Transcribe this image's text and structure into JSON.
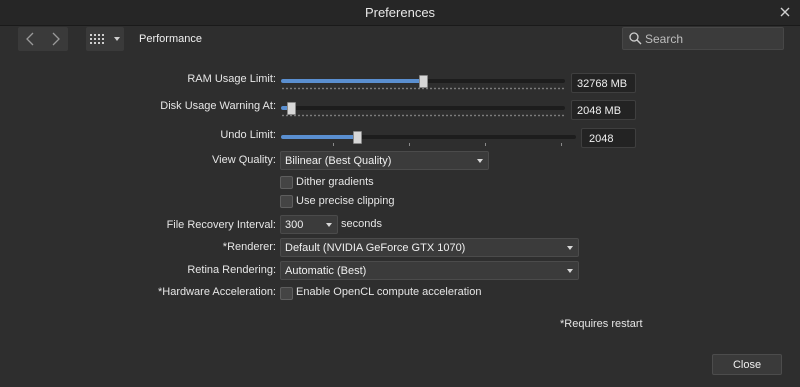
{
  "window": {
    "title": "Preferences"
  },
  "toolbar": {
    "section_label": "Performance",
    "search_placeholder": "Search"
  },
  "settings": {
    "ram": {
      "label": "RAM Usage Limit:",
      "value": "32768 MB",
      "level": 0.5
    },
    "disk": {
      "label": "Disk Usage Warning At:",
      "value": "2048 MB",
      "level": 0.02
    },
    "undo": {
      "label": "Undo Limit:",
      "value": "2048",
      "level": 0.25
    },
    "view_quality": {
      "label": "View Quality:",
      "value": "Bilinear (Best Quality)"
    },
    "dither": {
      "label": "Dither gradients",
      "checked": false
    },
    "precise_clipping": {
      "label": "Use precise clipping",
      "checked": false
    },
    "file_recovery": {
      "label": "File Recovery Interval:",
      "value": "300",
      "unit": "seconds"
    },
    "renderer": {
      "label": "*Renderer:",
      "value": "Default (NVIDIA GeForce GTX 1070)"
    },
    "retina": {
      "label": "Retina Rendering:",
      "value": "Automatic (Best)"
    },
    "hw_accel": {
      "label": "*Hardware Acceleration:",
      "checkbox_label": "Enable OpenCL compute acceleration",
      "checked": false
    }
  },
  "footer": {
    "note": "*Requires restart",
    "close_label": "Close"
  },
  "colors": {
    "accent": "#5a8fd0",
    "background": "#2e2e2e",
    "titlebar": "#262626"
  }
}
